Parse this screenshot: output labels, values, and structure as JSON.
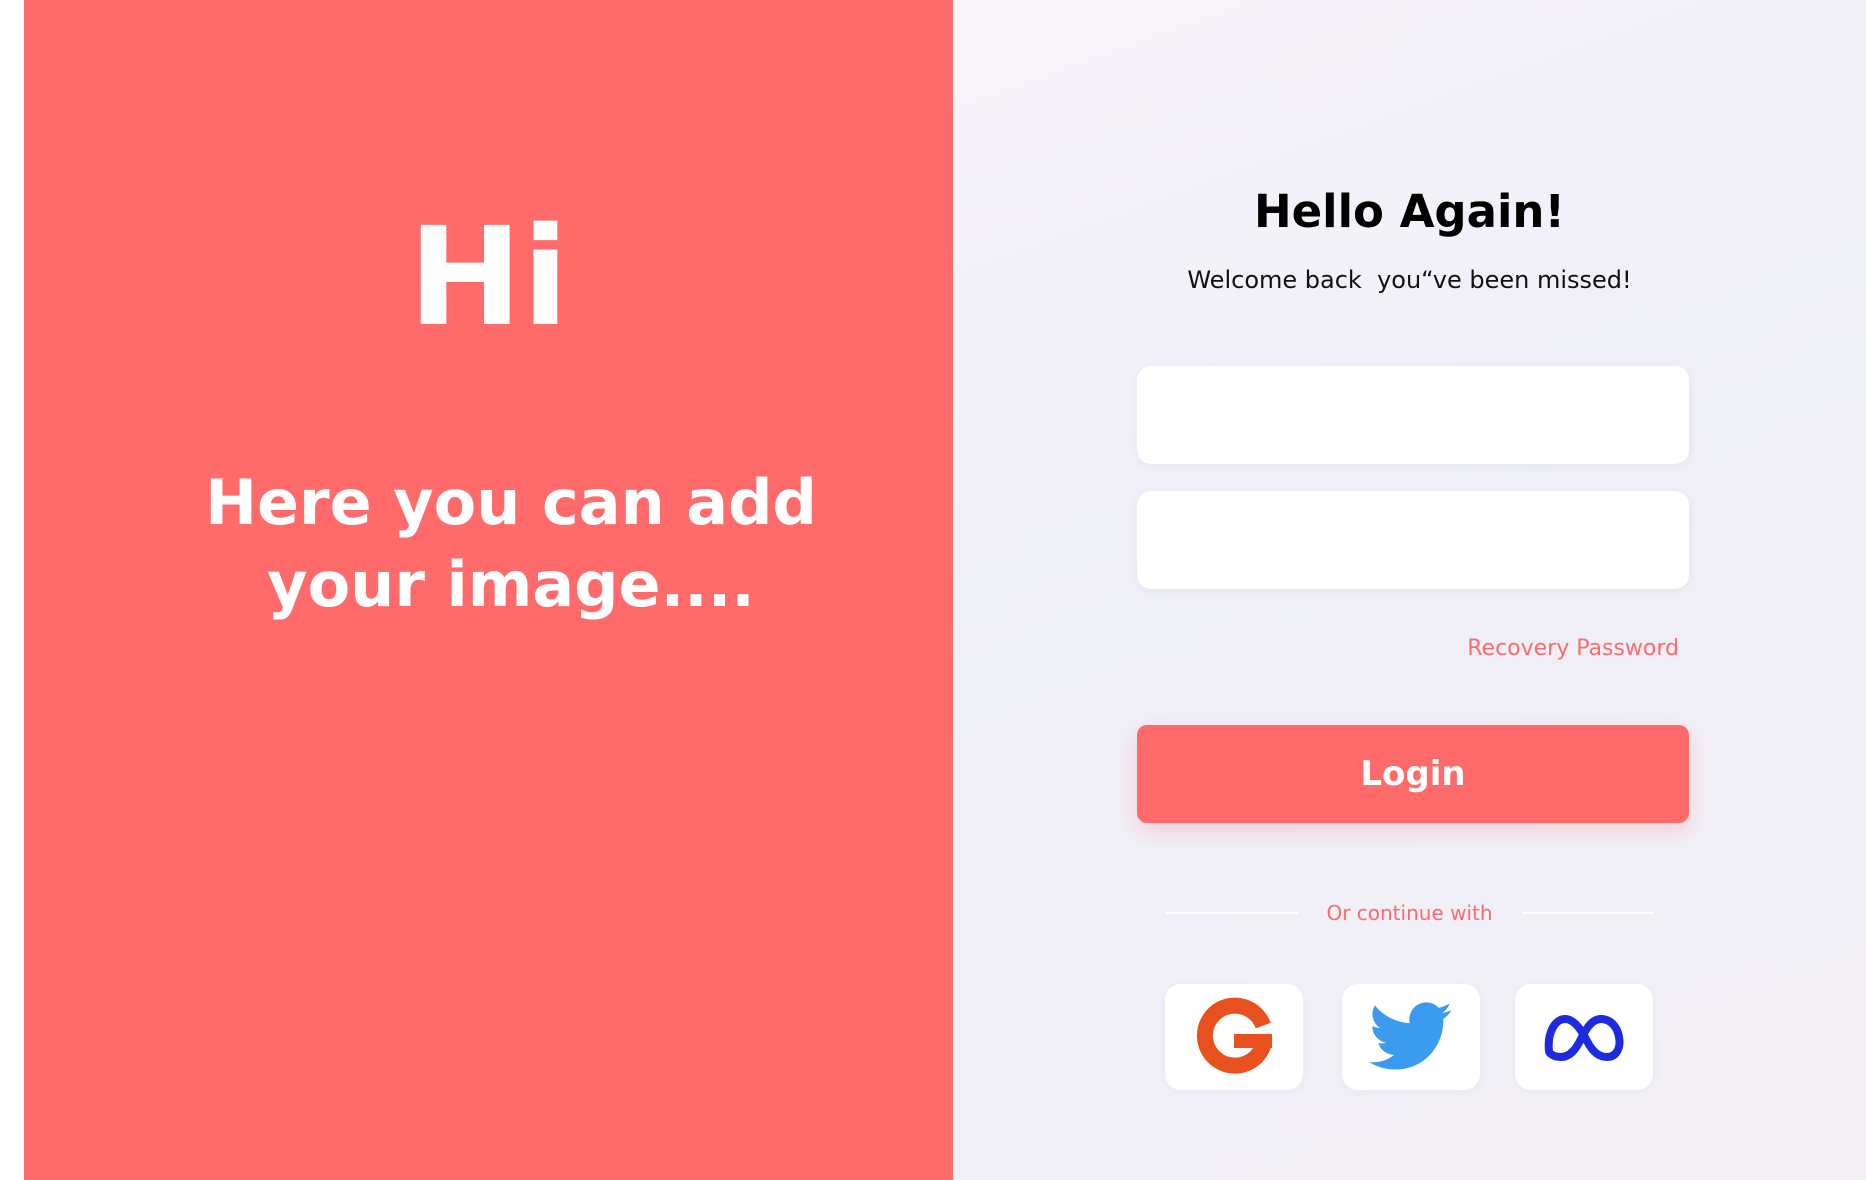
{
  "left_panel": {
    "greeting": "Hi",
    "placeholder_line1": "Here you can add",
    "placeholder_line2": "your image...."
  },
  "login_form": {
    "title": "Hello Again!",
    "subtitle": "Welcome back  you“ve been missed!",
    "username_value": "",
    "password_value": "",
    "recovery_link": "Recovery Password",
    "login_button": "Login",
    "divider_text": "Or continue with",
    "social": [
      {
        "name": "google",
        "icon": "google-icon"
      },
      {
        "name": "twitter",
        "icon": "twitter-icon"
      },
      {
        "name": "meta",
        "icon": "meta-icon"
      }
    ]
  },
  "colors": {
    "accent": "#FF6B6A",
    "google": "#E8501E",
    "twitter": "#3A9BEF",
    "meta": "#1C2BE0"
  }
}
